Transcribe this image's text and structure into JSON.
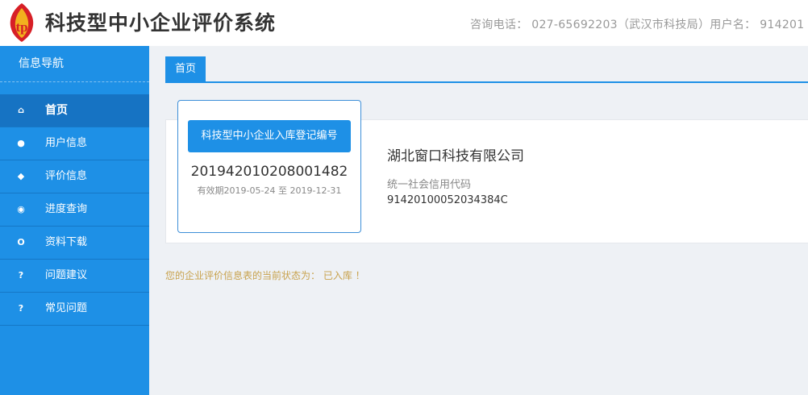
{
  "header": {
    "app_title": "科技型中小企业评价系统",
    "info": "咨询电话： 027-65692203（武汉市科技局）用户名： 914201"
  },
  "sidebar": {
    "title": "信息导航",
    "items": [
      {
        "label": "首页",
        "icon": "home-icon",
        "glyph": "⌂",
        "active": true
      },
      {
        "label": "用户信息",
        "icon": "user-icon",
        "glyph": "●",
        "active": false
      },
      {
        "label": "评价信息",
        "icon": "tag-icon",
        "glyph": "◆",
        "active": false
      },
      {
        "label": "进度查询",
        "icon": "eye-icon",
        "glyph": "◉",
        "active": false
      },
      {
        "label": "资料下载",
        "icon": "download-icon",
        "glyph": "O",
        "active": false
      },
      {
        "label": "问题建议",
        "icon": "question-icon",
        "glyph": "?",
        "active": false
      },
      {
        "label": "常见问题",
        "icon": "question-icon",
        "glyph": "?",
        "active": false
      }
    ]
  },
  "tabs": [
    {
      "label": "首页",
      "active": true
    }
  ],
  "certificate": {
    "title": "科技型中小企业入库登记编号",
    "number": "201942010208001482",
    "validity": "有效期2019-05-24 至 2019-12-31"
  },
  "company": {
    "name": "湖北窗口科技有限公司",
    "credit_label": "统一社会信用代码",
    "credit_code": "91420100052034384C"
  },
  "status_text": "您的企业评价信息表的当前状态为： 已入库 ！",
  "colors": {
    "accent": "#1e90e6",
    "sidebar_active": "#1673c3",
    "status": "#c8a24d",
    "logo_red": "#d71f26",
    "logo_gold": "#f2b01e"
  }
}
